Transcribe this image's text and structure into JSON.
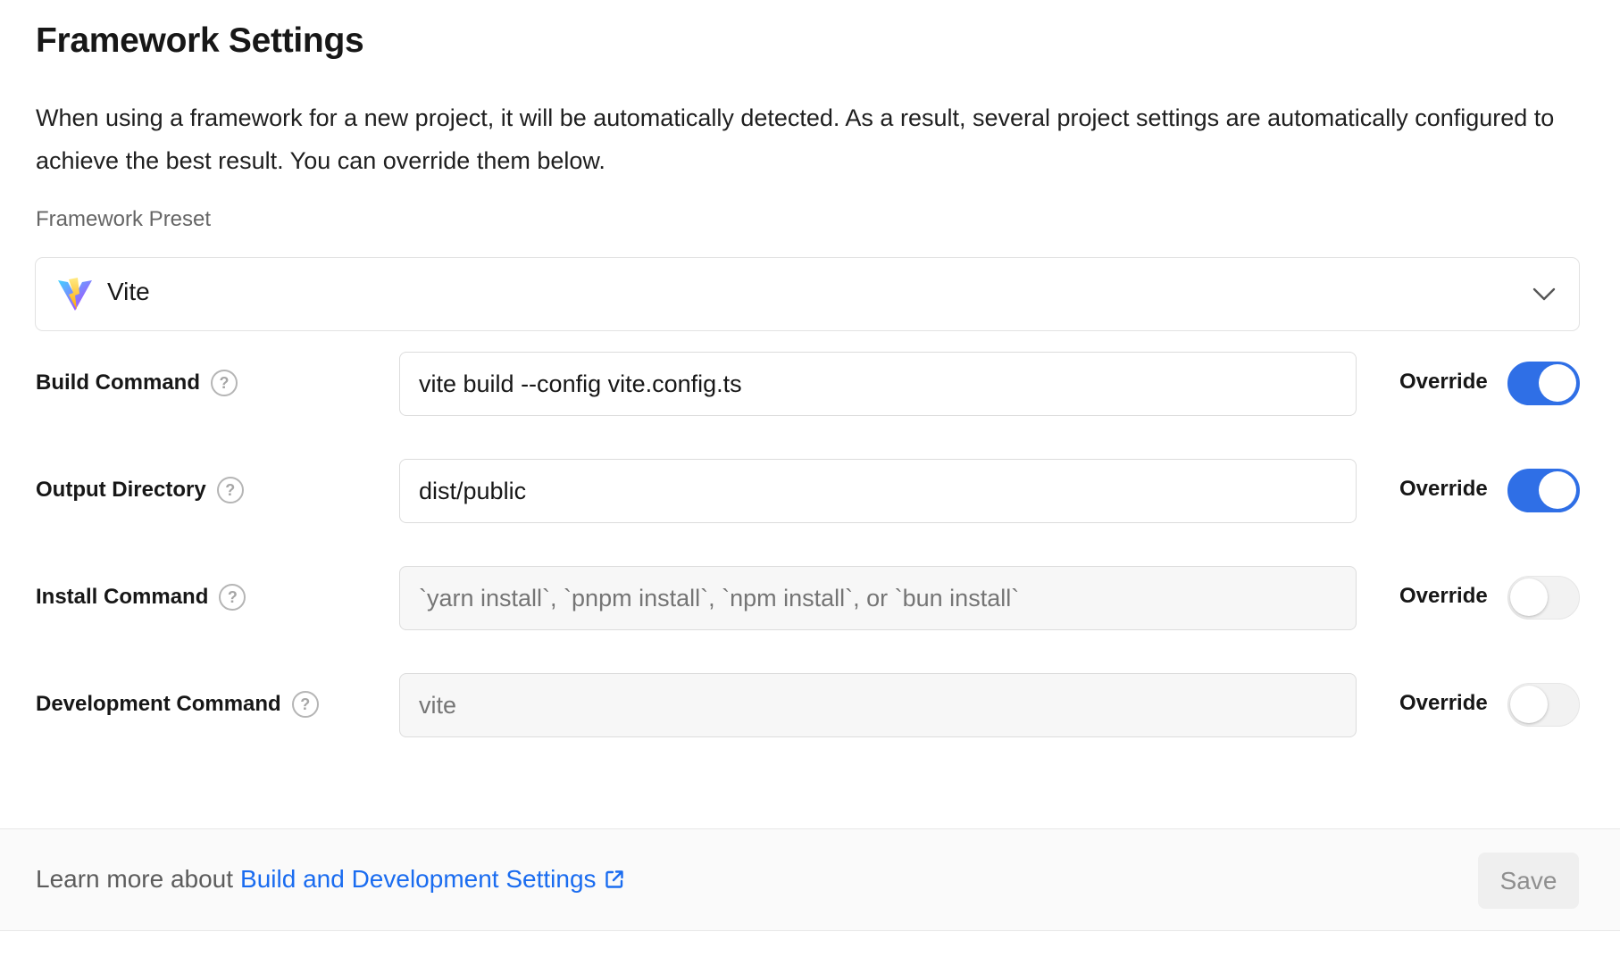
{
  "header": {
    "title": "Framework Settings",
    "description": "When using a framework for a new project, it will be automatically detected. As a result, several project settings are automatically configured to achieve the best result. You can override them below."
  },
  "preset": {
    "label": "Framework Preset",
    "selected": "Vite",
    "icon": "vite-logo-icon"
  },
  "rows": [
    {
      "label": "Build Command",
      "value": "vite build --config vite.config.ts",
      "placeholder": "",
      "override_label": "Override",
      "override": true
    },
    {
      "label": "Output Directory",
      "value": "dist/public",
      "placeholder": "",
      "override_label": "Override",
      "override": true
    },
    {
      "label": "Install Command",
      "value": "",
      "placeholder": "`yarn install`, `pnpm install`, `npm install`, or `bun install`",
      "override_label": "Override",
      "override": false
    },
    {
      "label": "Development Command",
      "value": "",
      "placeholder": "vite",
      "override_label": "Override",
      "override": false
    }
  ],
  "footer": {
    "learn_prefix": "Learn more about",
    "learn_link": "Build and Development Settings",
    "save_label": "Save"
  },
  "colors": {
    "accent": "#2f6fe6",
    "link": "#1a6cf0"
  }
}
